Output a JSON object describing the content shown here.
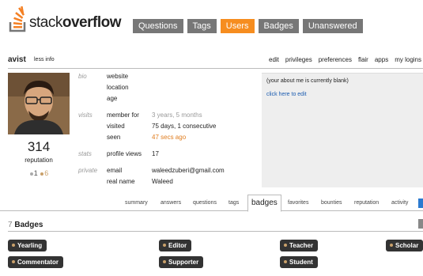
{
  "logo": {
    "text_light": "stack",
    "text_bold": "overflow"
  },
  "nav": [
    {
      "label": "Questions",
      "active": false
    },
    {
      "label": "Tags",
      "active": false
    },
    {
      "label": "Users",
      "active": true
    },
    {
      "label": "Badges",
      "active": false
    },
    {
      "label": "Unanswered",
      "active": false
    }
  ],
  "user": {
    "name": "avist",
    "less_info": "less info",
    "reputation": "314",
    "reputation_label": "reputation",
    "silver": "1",
    "bronze": "6"
  },
  "top_links": [
    "edit",
    "privileges",
    "preferences",
    "flair",
    "apps",
    "my logins"
  ],
  "profile": {
    "sections": {
      "bio": "bio",
      "visits": "visits",
      "stats": "stats",
      "private": "private"
    },
    "website_label": "website",
    "location_label": "location",
    "age_label": "age",
    "member_for_label": "member for",
    "member_for_value": "3 years, 5 months",
    "visited_label": "visited",
    "visited_value": "75 days, 1 consecutive",
    "seen_label": "seen",
    "seen_value": "47 secs ago",
    "profile_views_label": "profile views",
    "profile_views_value": "17",
    "email_label": "email",
    "email_value": "waleedzuberi@gmail.com",
    "real_name_label": "real name",
    "real_name_value": "Waleed"
  },
  "about": {
    "blank_text": "(your about me is currently blank)",
    "edit_link": "click here to edit"
  },
  "subtabs": [
    "summary",
    "answers",
    "questions",
    "tags",
    "badges",
    "favorites",
    "bounties",
    "reputation",
    "activity"
  ],
  "subtab_active": "badges",
  "badges_section": {
    "count": "7",
    "title": "Badges",
    "items": [
      "Yearling",
      "Editor",
      "Teacher",
      "Scholar",
      "Commentator",
      "Supporter",
      "Student"
    ]
  },
  "colors": {
    "accent": "#f68d1f",
    "tab": "#777777",
    "badge_bg": "#333333",
    "bronze": "#c9a06a",
    "link": "#1a5bb0"
  }
}
